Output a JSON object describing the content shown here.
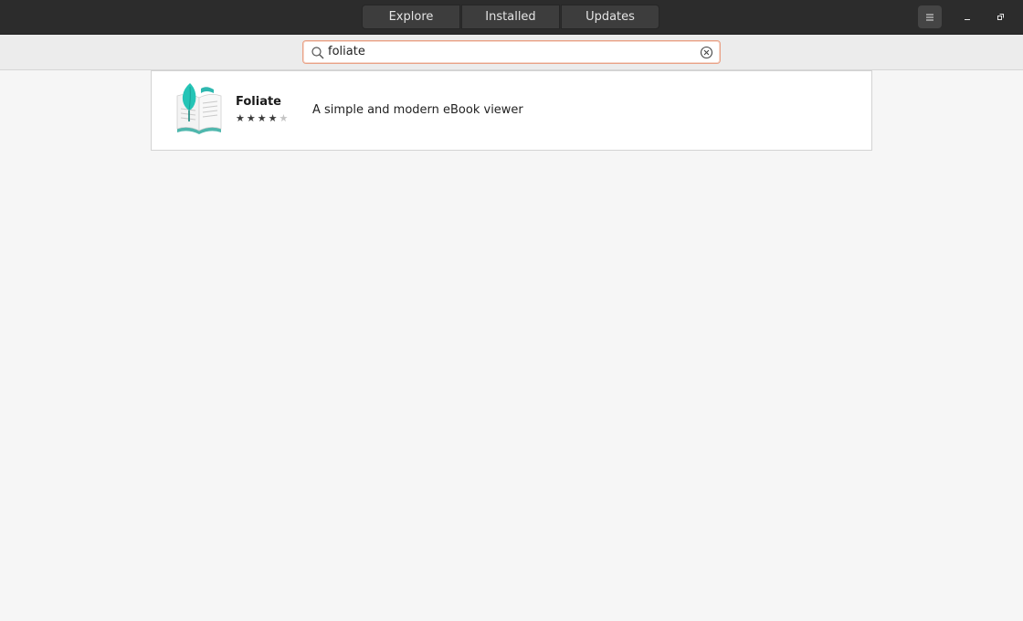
{
  "header": {
    "tabs": [
      {
        "label": "Explore"
      },
      {
        "label": "Installed"
      },
      {
        "label": "Updates"
      }
    ],
    "menu_icon": "hamburger-menu-icon",
    "window_controls": [
      "minimize-icon",
      "restore-icon"
    ]
  },
  "search": {
    "value": "foliate",
    "icon": "search-icon",
    "clear_icon": "clear-icon",
    "accent_color": "#e9a287"
  },
  "results": [
    {
      "name": "Foliate",
      "summary": "A simple and modern eBook viewer",
      "rating_stars": 4,
      "rating_max": 5,
      "icon": "foliate-book-leaf-icon"
    }
  ]
}
